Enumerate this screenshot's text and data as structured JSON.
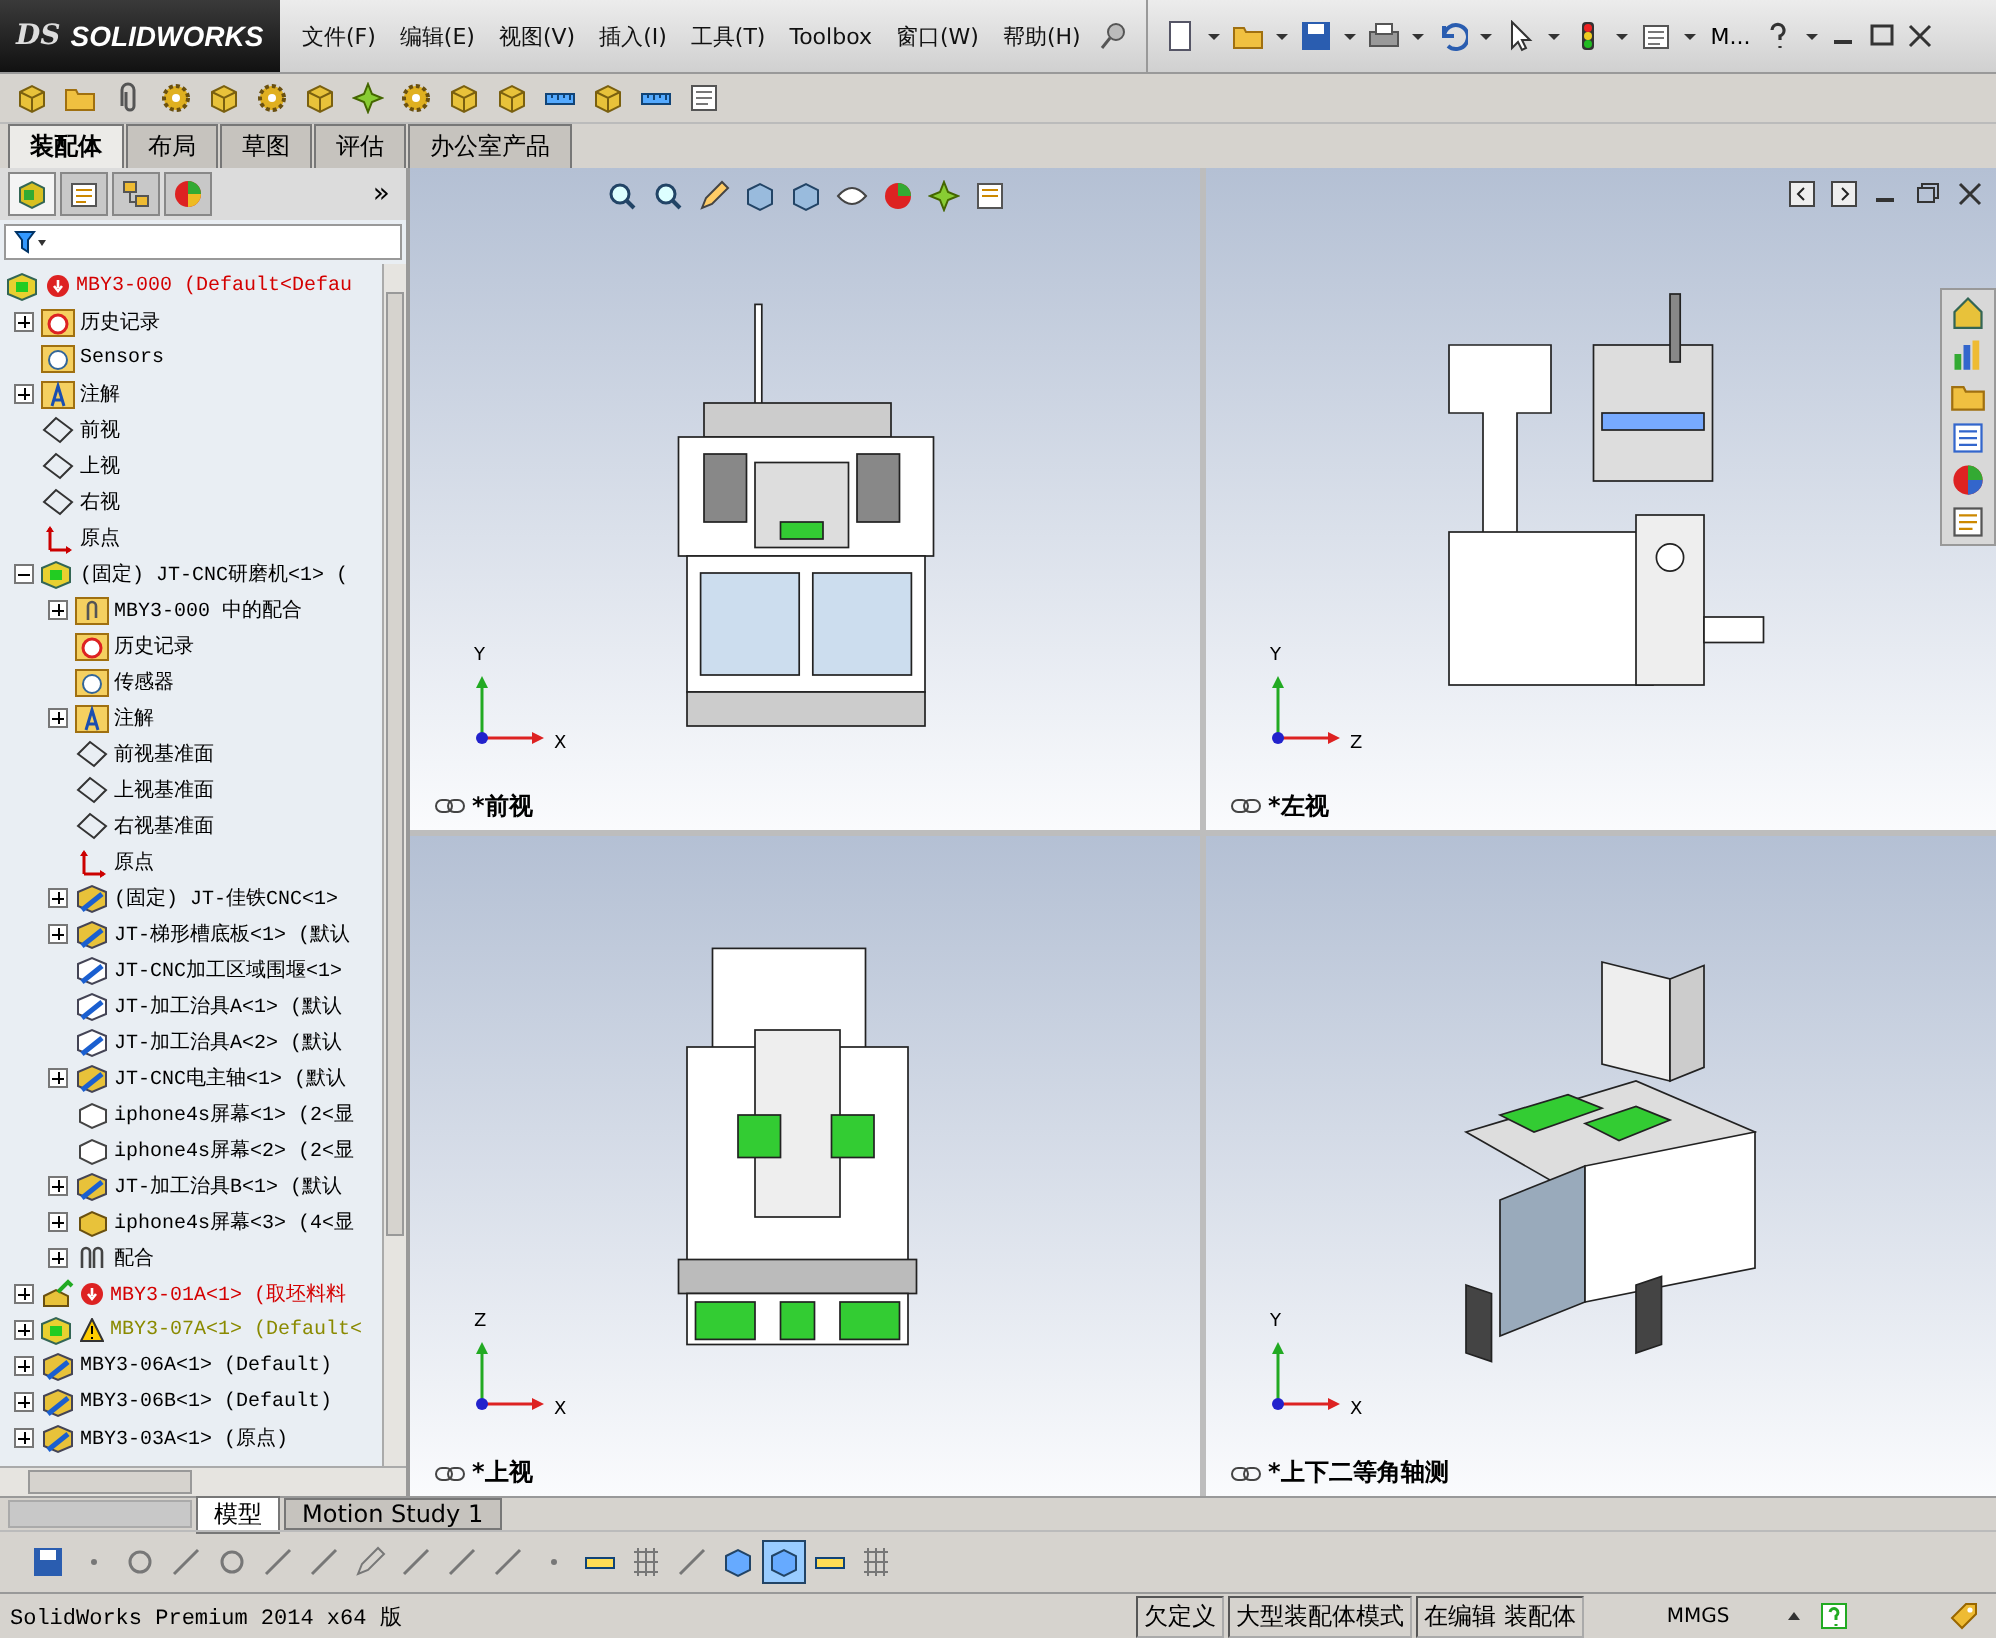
{
  "logo": {
    "mark": "DS",
    "name": "SOLIDWORKS"
  },
  "menu": [
    "文件(F)",
    "编辑(E)",
    "视图(V)",
    "插入(I)",
    "工具(T)",
    "Toolbox",
    "窗口(W)",
    "帮助(H)"
  ],
  "quick_access": {
    "overflow": "M..."
  },
  "command_tabs": [
    {
      "label": "装配体",
      "selected": true
    },
    {
      "label": "布局",
      "selected": false
    },
    {
      "label": "草图",
      "selected": false
    },
    {
      "label": "评估",
      "selected": false
    },
    {
      "label": "办公室产品",
      "selected": false
    }
  ],
  "panel_tabs": [
    {
      "kind": "feature-tree",
      "selected": true
    },
    {
      "kind": "property",
      "selected": false
    },
    {
      "kind": "config",
      "selected": false
    },
    {
      "kind": "display",
      "selected": false
    }
  ],
  "panel_more": "»",
  "tree": [
    {
      "label": "MBY3-000 (Default<Defau",
      "kind": "assembly",
      "error": true,
      "warning": false,
      "children": [
        {
          "label": "历史记录",
          "kind": "history",
          "expanded": false,
          "error": false,
          "warning": false
        },
        {
          "label": "Sensors",
          "kind": "sensor",
          "error": false,
          "warning": false
        },
        {
          "label": "注解",
          "kind": "annotation",
          "expanded": false,
          "error": false,
          "warning": false
        },
        {
          "label": "前视",
          "kind": "plane",
          "error": false,
          "warning": false
        },
        {
          "label": "上视",
          "kind": "plane",
          "error": false,
          "warning": false
        },
        {
          "label": "右视",
          "kind": "plane",
          "error": false,
          "warning": false
        },
        {
          "label": "原点",
          "kind": "origin",
          "error": false,
          "warning": false
        },
        {
          "label": "(固定) JT-CNC研磨机<1> (",
          "kind": "assembly",
          "expanded": true,
          "error": false,
          "warning": false,
          "children": [
            {
              "label": "MBY3-000 中的配合",
              "kind": "mates-folder",
              "expanded": false
            },
            {
              "label": "历史记录",
              "kind": "history"
            },
            {
              "label": "传感器",
              "kind": "sensor"
            },
            {
              "label": "注解",
              "kind": "annotation",
              "expanded": false
            },
            {
              "label": "前视基准面",
              "kind": "plane"
            },
            {
              "label": "上视基准面",
              "kind": "plane"
            },
            {
              "label": "右视基准面",
              "kind": "plane"
            },
            {
              "label": "原点",
              "kind": "origin"
            },
            {
              "label": "(固定) JT-佳铁CNC<1>",
              "kind": "subassembly",
              "expanded": false
            },
            {
              "label": "JT-梯形槽底板<1> (默认",
              "kind": "subassembly",
              "expanded": false
            },
            {
              "label": "JT-CNC加工区域围堰<1>",
              "kind": "subassembly-hidden"
            },
            {
              "label": "JT-加工治具A<1> (默认",
              "kind": "subassembly-hidden"
            },
            {
              "label": "JT-加工治具A<2> (默认",
              "kind": "subassembly-hidden"
            },
            {
              "label": "JT-CNC电主轴<1> (默认",
              "kind": "subassembly",
              "expanded": false
            },
            {
              "label": "iphone4s屏幕<1> (2<显",
              "kind": "part-hidden"
            },
            {
              "label": "iphone4s屏幕<2> (2<显",
              "kind": "part-hidden"
            },
            {
              "label": "JT-加工治具B<1> (默认",
              "kind": "subassembly",
              "expanded": false
            },
            {
              "label": "iphone4s屏幕<3> (4<显",
              "kind": "part",
              "expanded": false
            },
            {
              "label": "配合",
              "kind": "mates",
              "expanded": false
            }
          ]
        },
        {
          "label": "MBY3-01A<1> (取坯料料",
          "kind": "assembly-edit",
          "error": true,
          "warning": false,
          "expanded": false
        },
        {
          "label": "MBY3-07A<1> (Default<",
          "kind": "assembly",
          "error": false,
          "warning": true,
          "expanded": false
        },
        {
          "label": "MBY3-06A<1> (Default)",
          "kind": "subassembly",
          "error": false,
          "warning": false,
          "expanded": false
        },
        {
          "label": "MBY3-06B<1> (Default)",
          "kind": "subassembly",
          "error": false,
          "warning": false,
          "expanded": false
        },
        {
          "label": "MBY3-03A<1> (原点)",
          "kind": "subassembly",
          "error": false,
          "warning": false,
          "expanded": false
        }
      ]
    }
  ],
  "viewports": [
    {
      "kind": "front",
      "label": "*前视",
      "axis_vertical": "Y",
      "axis_horizontal": "X"
    },
    {
      "kind": "left",
      "label": "*左视",
      "axis_vertical": "Y",
      "axis_horizontal": "Z"
    },
    {
      "kind": "top",
      "label": "*上视",
      "axis_vertical": "Z",
      "axis_horizontal": "X"
    },
    {
      "kind": "iso",
      "label": "*上下二等角轴测",
      "axis_vertical": "Y",
      "axis_horizontal": "X"
    }
  ],
  "bottom_tabs": [
    {
      "label": "模型",
      "selected": true
    },
    {
      "label": "Motion Study 1",
      "selected": false
    }
  ],
  "status_bar": {
    "product": "SolidWorks Premium 2014 x64 版",
    "fields": [
      "欠定义",
      "大型装配体模式",
      "在编辑 装配体"
    ],
    "units": "MMGS"
  }
}
